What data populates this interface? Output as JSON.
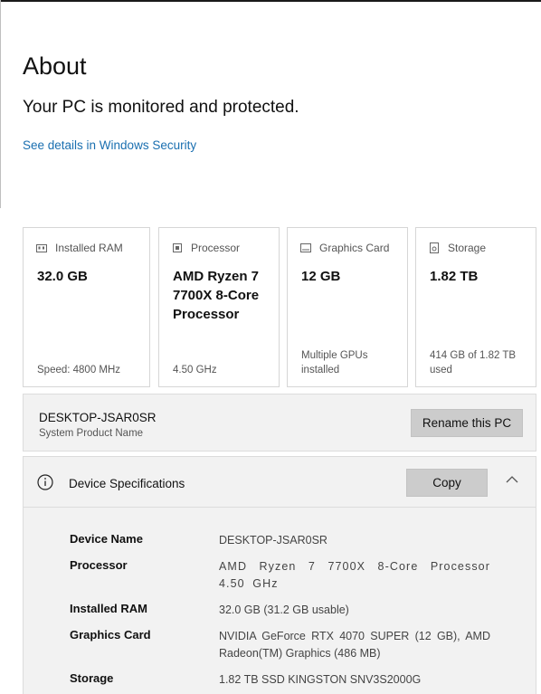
{
  "page": {
    "title": "About",
    "status": "Your PC is monitored and protected.",
    "security_link": "See details in Windows Security"
  },
  "cards": [
    {
      "label": "Installed RAM",
      "value": "32.0 GB",
      "foot": "Speed: 4800 MHz",
      "icon": "ram-icon"
    },
    {
      "label": "Processor",
      "value": "AMD Ryzen 7 7700X 8-Core Processor",
      "foot": "4.50 GHz",
      "icon": "processor-icon"
    },
    {
      "label": "Graphics Card",
      "value": "12 GB",
      "foot": "Multiple GPUs installed",
      "icon": "graphics-card-icon"
    },
    {
      "label": "Storage",
      "value": "1.82 TB",
      "foot": "414 GB of 1.82 TB used",
      "icon": "storage-icon"
    }
  ],
  "pc": {
    "name": "DESKTOP-JSAR0SR",
    "subtitle": "System Product Name",
    "rename_label": "Rename this PC"
  },
  "specs": {
    "title": "Device Specifications",
    "copy_label": "Copy",
    "icon": "info-icon",
    "rows": [
      {
        "label": "Device Name",
        "value": "DESKTOP-JSAR0SR"
      },
      {
        "label": "Processor",
        "value": "AMD Ryzen 7 7700X 8-Core Processor 4.50 GHz"
      },
      {
        "label": "Installed RAM",
        "value": "32.0 GB (31.2 GB usable)"
      },
      {
        "label": "Graphics Card",
        "value": "NVIDIA GeForce RTX 4070 SUPER (12 GB), AMD Radeon(TM) Graphics (486 MB)"
      },
      {
        "label": "Storage",
        "value": "1.82 TB SSD KINGSTON SNV3S2000G"
      }
    ]
  },
  "colors": {
    "link": "#1a6fb0",
    "button": "#cccccc",
    "panel": "#f2f2f2"
  }
}
